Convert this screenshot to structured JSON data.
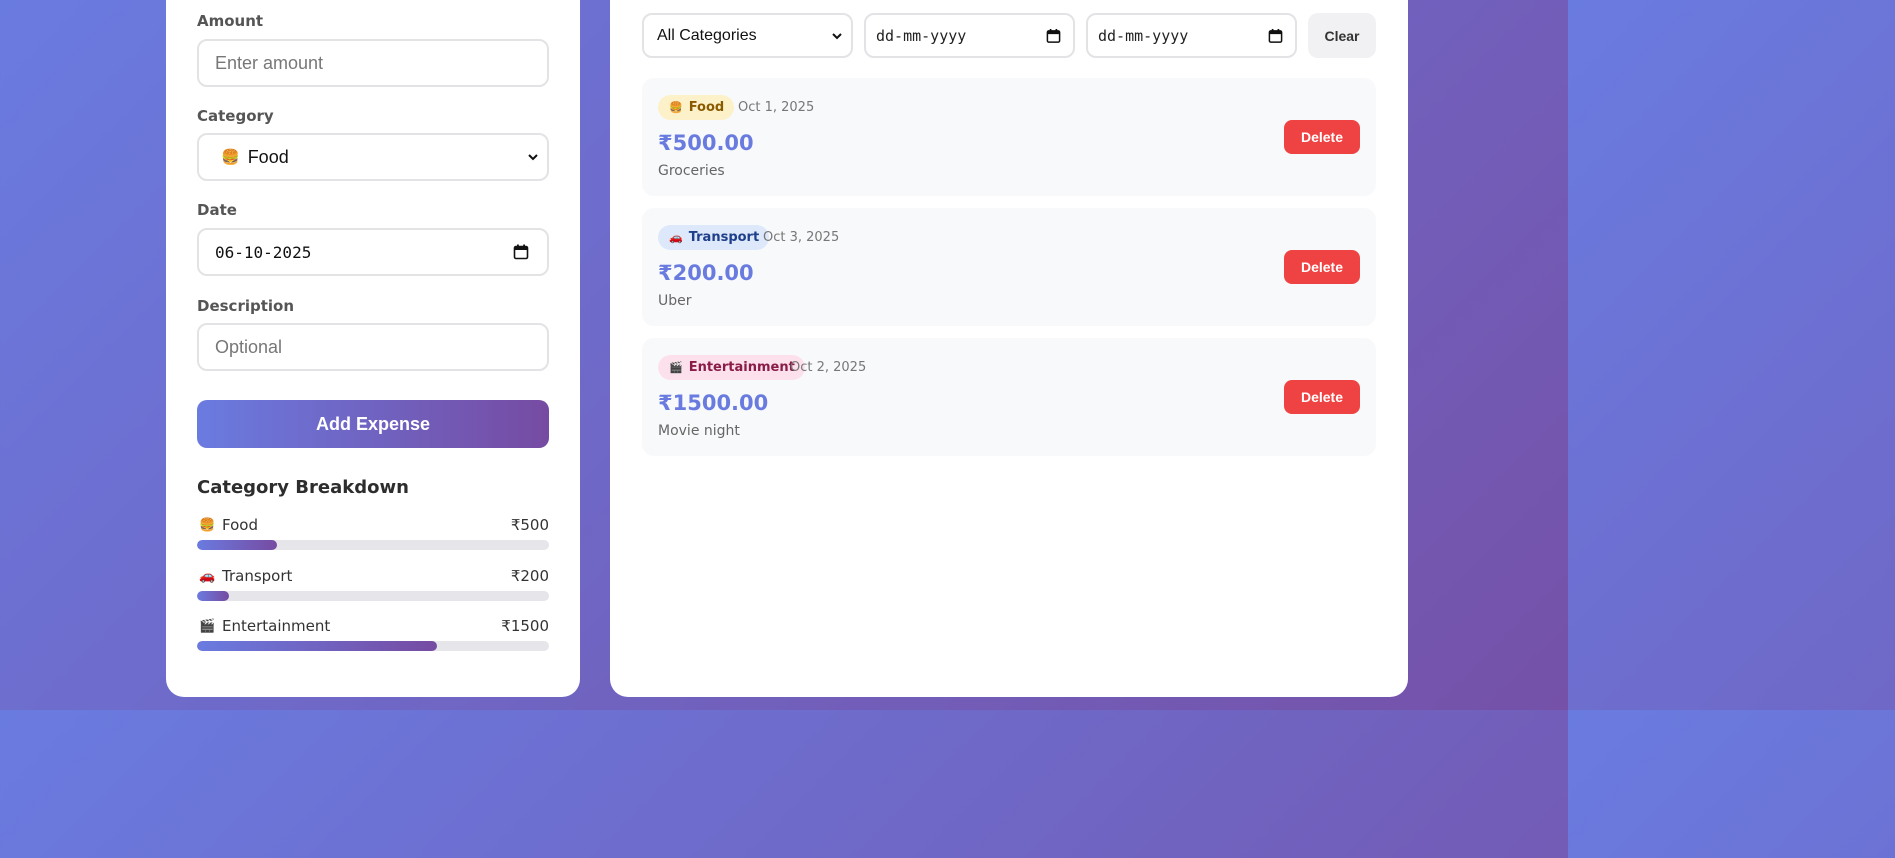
{
  "form": {
    "amount_label": "Amount",
    "amount_placeholder": "Enter amount",
    "category_label": "Category",
    "category_selected_emoji": "🍔",
    "category_selected": "Food",
    "date_label": "Date",
    "date_value": "06-10-2025",
    "description_label": "Description",
    "description_placeholder": "Optional",
    "add_button": "Add Expense"
  },
  "breakdown": {
    "title": "Category Breakdown",
    "items": [
      {
        "emoji": "🍔",
        "label": "Food",
        "amount": "₹500",
        "fraction": 0.2273
      },
      {
        "emoji": "🚗",
        "label": "Transport",
        "amount": "₹200",
        "fraction": 0.0909
      },
      {
        "emoji": "🎬",
        "label": "Entertainment",
        "amount": "₹1500",
        "fraction": 0.6818
      }
    ]
  },
  "filters": {
    "category": "All Categories",
    "date_from": "dd-mm-yyyy",
    "date_to": "dd-mm-yyyy",
    "clear": "Clear"
  },
  "expenses": [
    {
      "emoji": "🍔",
      "category": "Food",
      "date": "Oct 1, 2025",
      "amount": "₹500.00",
      "description": "Groceries",
      "delete": "Delete"
    },
    {
      "emoji": "🚗",
      "category": "Transport",
      "date": "Oct 3, 2025",
      "amount": "₹200.00",
      "description": "Uber",
      "delete": "Delete"
    },
    {
      "emoji": "🎬",
      "category": "Entertainment",
      "date": "Oct 2, 2025",
      "amount": "₹1500.00",
      "description": "Movie night",
      "delete": "Delete"
    }
  ],
  "icons": {
    "chevron": "chevron-down-icon",
    "calendar": "calendar-icon"
  },
  "colors": {
    "accent": "#6a7be0",
    "accent_end": "#764ba2",
    "delete": "#ef4343"
  }
}
